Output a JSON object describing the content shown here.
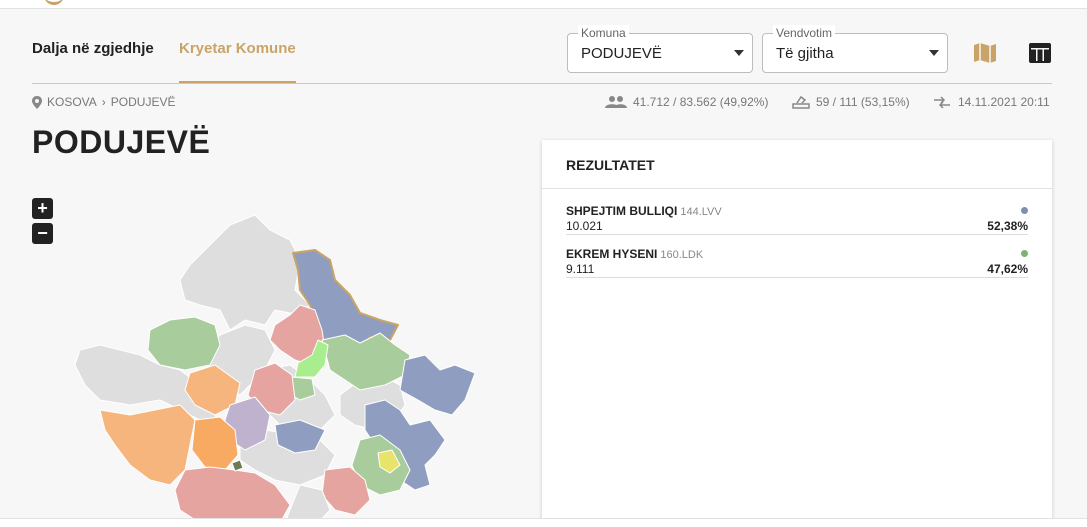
{
  "tabs": [
    {
      "label": "Dalja në zgjedhje",
      "active": false
    },
    {
      "label": "Kryetar Komune",
      "active": true
    }
  ],
  "filters": {
    "komuna": {
      "label": "Komuna",
      "value": "PODUJEVË"
    },
    "vendvotim": {
      "label": "Vendvotim",
      "value": "Të gjitha"
    }
  },
  "icons": {
    "map": "map-icon",
    "table": "table-icon",
    "location": "location-pin-icon",
    "people": "people-icon",
    "ballot": "ballot-box-icon",
    "update": "update-arrows-icon"
  },
  "breadcrumb": {
    "root": "KOSOVA",
    "current": "PODUJEVË"
  },
  "stats": {
    "turnout": "41.712 / 83.562 (49,92%)",
    "stations": "59 / 111 (53,15%)",
    "updated": "14.11.2021 20:11"
  },
  "page_title": "PODUJEVË",
  "zoom": {
    "in": "+",
    "out": "−"
  },
  "results": {
    "title": "REZULTATET",
    "candidates": [
      {
        "name": "SHPEJTIM BULLIQI",
        "party": "144.LVV",
        "votes": "10.021",
        "percent": "52,38%",
        "color": "#7f8fb0"
      },
      {
        "name": "EKREM HYSENI",
        "party": "160.LDK",
        "votes": "9.111",
        "percent": "47,62%",
        "color": "#7bb36f"
      }
    ]
  },
  "colors": {
    "accent": "#c9a466",
    "blue": "#8f9ec0",
    "green": "#a9cc9c",
    "red": "#e5a4a0",
    "orange": "#f6b57d",
    "purple": "#bfb2cf",
    "grey": "#dedede"
  }
}
